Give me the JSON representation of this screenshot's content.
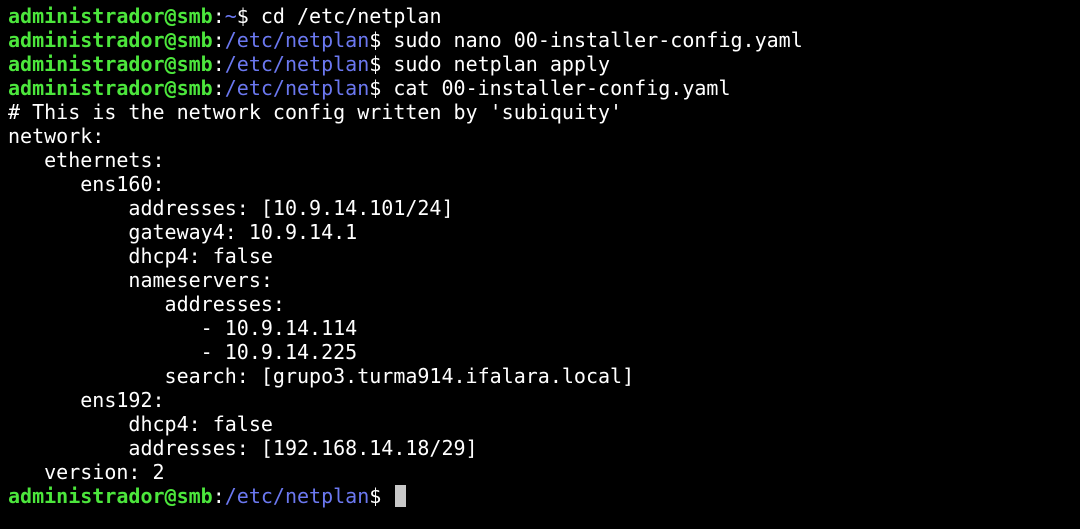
{
  "colors": {
    "background": "#000000",
    "prompt_user": "#4ce63c",
    "prompt_path": "#6b78f0",
    "text": "#ffffff",
    "cursor": "#c8c8c8"
  },
  "prompt": {
    "user_host": "administrador@smb",
    "separator": ":",
    "symbol": "$"
  },
  "lines": [
    {
      "kind": "prompt",
      "path": "~",
      "command": " cd /etc/netplan"
    },
    {
      "kind": "prompt",
      "path": "/etc/netplan",
      "command": " sudo nano 00-installer-config.yaml"
    },
    {
      "kind": "prompt",
      "path": "/etc/netplan",
      "command": " sudo netplan apply"
    },
    {
      "kind": "prompt",
      "path": "/etc/netplan",
      "command": " cat 00-installer-config.yaml"
    },
    {
      "kind": "output",
      "text": "# This is the network config written by 'subiquity'"
    },
    {
      "kind": "output",
      "text": "network:"
    },
    {
      "kind": "output",
      "text": "   ethernets:"
    },
    {
      "kind": "output",
      "text": "      ens160:"
    },
    {
      "kind": "output",
      "text": "          addresses: [10.9.14.101/24]"
    },
    {
      "kind": "output",
      "text": "          gateway4: 10.9.14.1"
    },
    {
      "kind": "output",
      "text": "          dhcp4: false"
    },
    {
      "kind": "output",
      "text": "          nameservers:"
    },
    {
      "kind": "output",
      "text": "             addresses:"
    },
    {
      "kind": "output",
      "text": "                - 10.9.14.114"
    },
    {
      "kind": "output",
      "text": "                - 10.9.14.225"
    },
    {
      "kind": "output",
      "text": "             search: [grupo3.turma914.ifalara.local]"
    },
    {
      "kind": "output",
      "text": "      ens192:"
    },
    {
      "kind": "output",
      "text": "          dhcp4: false"
    },
    {
      "kind": "output",
      "text": "          addresses: [192.168.14.18/29]"
    },
    {
      "kind": "output",
      "text": "   version: 2"
    },
    {
      "kind": "prompt",
      "path": "/etc/netplan",
      "command": " ",
      "cursor": true
    }
  ]
}
